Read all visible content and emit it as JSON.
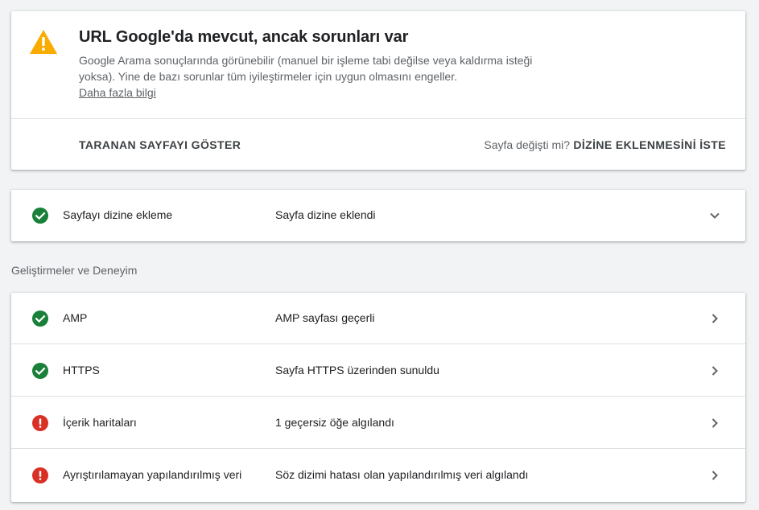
{
  "status": {
    "icon": "warning-icon",
    "title": "URL Google'da mevcut, ancak sorunları var",
    "description": "Google Arama sonuçlarında görünebilir (manuel bir işleme tabi değilse veya kaldırma isteği yoksa). Yine de bazı sorunlar tüm iyileştirmeler için uygun olmasını engeller.",
    "learn_more": "Daha fazla bilgi",
    "view_crawled": "TARANAN SAYFAYI GÖSTER",
    "changed_question": "Sayfa değişti mi?",
    "request_indexing": "DİZİNE EKLENMESİNİ İSTE",
    "warning_color": "#f9ab00"
  },
  "indexing": {
    "label": "Sayfayı dizine ekleme",
    "value": "Sayfa dizine eklendi",
    "icon": "check-circle-icon"
  },
  "enhancements": {
    "heading": "Geliştirmeler ve Deneyim",
    "items": [
      {
        "label": "AMP",
        "value": "AMP sayfası geçerli",
        "status": "ok"
      },
      {
        "label": "HTTPS",
        "value": "Sayfa HTTPS üzerinden sunuldu",
        "status": "ok"
      },
      {
        "label": "İçerik haritaları",
        "value": "1 geçersiz öğe algılandı",
        "status": "error"
      },
      {
        "label": "Ayrıştırılamayan yapılandırılmış veri",
        "value": "Söz dizimi hatası olan yapılandırılmış veri algılandı",
        "status": "error"
      }
    ]
  },
  "colors": {
    "ok": "#188038",
    "error": "#d93025"
  }
}
